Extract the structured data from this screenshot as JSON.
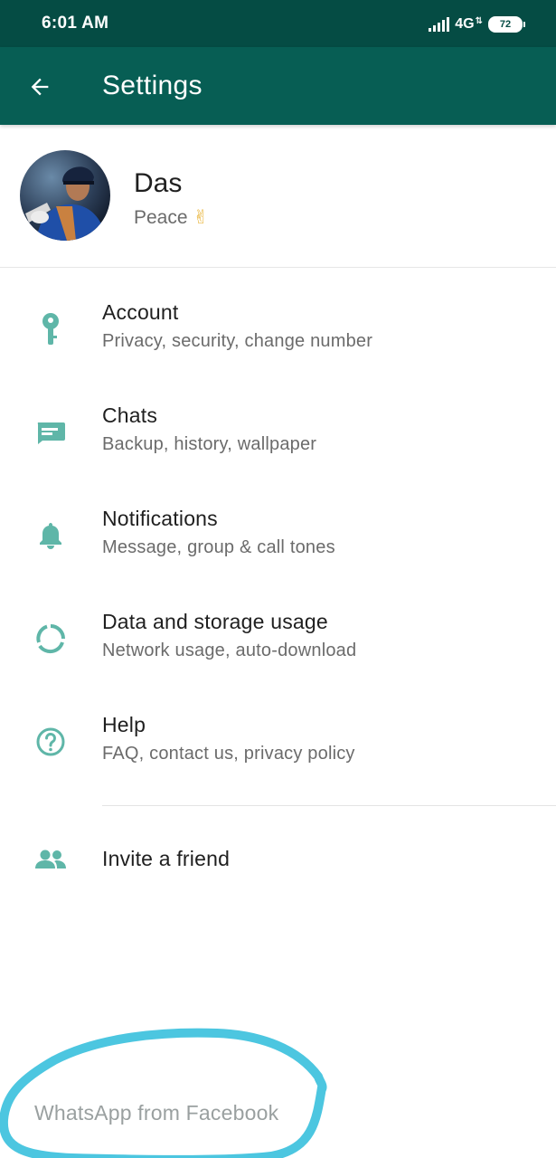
{
  "status_bar": {
    "time": "6:01 AM",
    "network": "4G",
    "battery": "72"
  },
  "app_bar": {
    "title": "Settings",
    "back_icon": "arrow-back-icon"
  },
  "profile": {
    "name": "Das",
    "status": "Peace",
    "status_emoji": "✌"
  },
  "menu": [
    {
      "icon": "key-icon",
      "title": "Account",
      "subtitle": "Privacy, security, change number"
    },
    {
      "icon": "chat-icon",
      "title": "Chats",
      "subtitle": "Backup, history, wallpaper"
    },
    {
      "icon": "bell-icon",
      "title": "Notifications",
      "subtitle": "Message, group & call tones"
    },
    {
      "icon": "data-usage-icon",
      "title": "Data and storage usage",
      "subtitle": "Network usage, auto-download"
    },
    {
      "icon": "help-icon",
      "title": "Help",
      "subtitle": "FAQ, contact us, privacy policy"
    }
  ],
  "invite": {
    "icon": "people-icon",
    "label": "Invite a friend"
  },
  "footer": {
    "text": "WhatsApp from Facebook"
  },
  "colors": {
    "status_bar": "#054c44",
    "app_bar": "#075e54",
    "icon_teal": "#5fb6a8",
    "annotation": "#4cc6e0"
  }
}
